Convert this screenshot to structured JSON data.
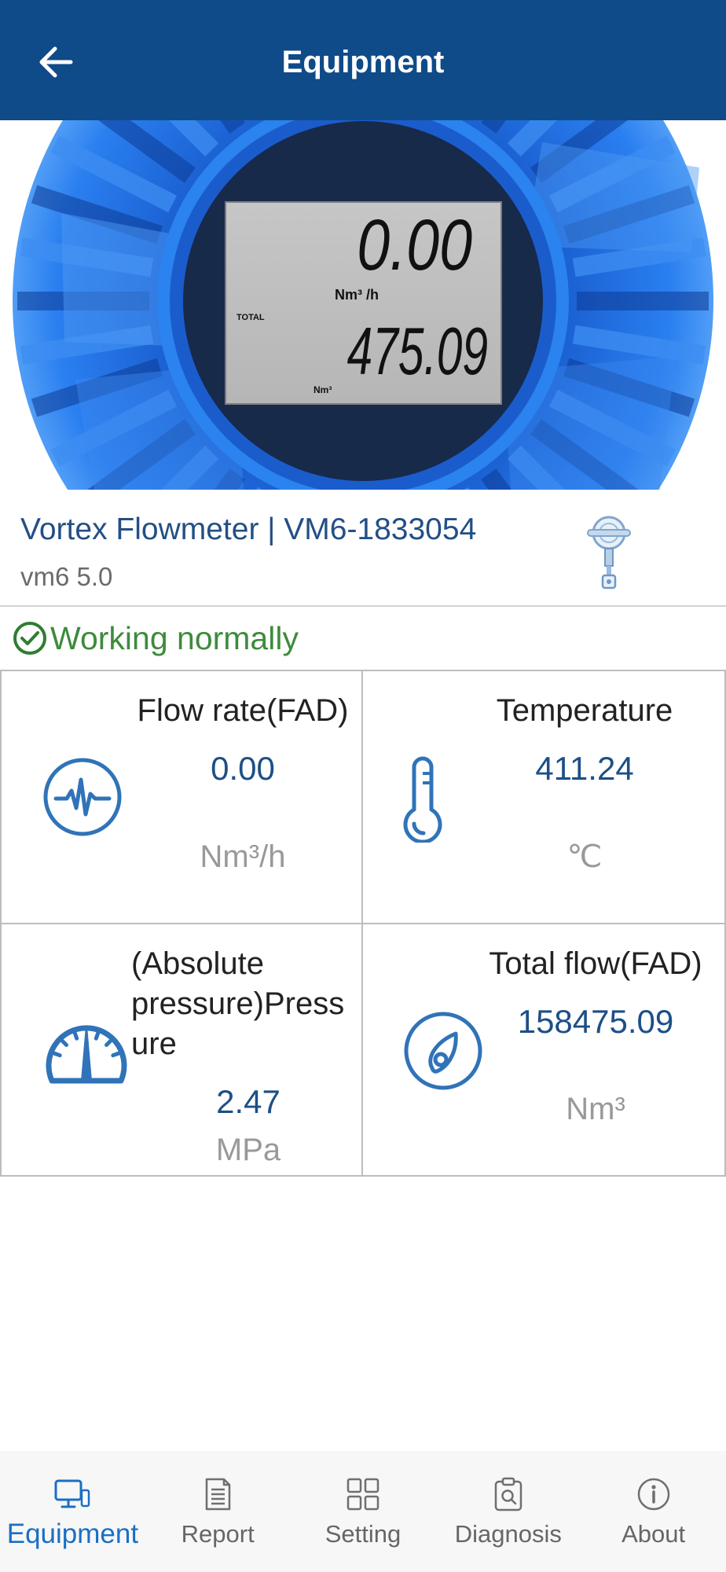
{
  "header": {
    "title": "Equipment",
    "back_icon": "arrow-left-icon"
  },
  "hero": {
    "lcd": {
      "flow_value": "0.00",
      "flow_unit": "Nm³ /h",
      "total_label": "TOTAL",
      "total_value": "475.09",
      "total_unit": "Nm³"
    }
  },
  "device": {
    "name": "Vortex Flowmeter",
    "serial": "| VM6-1833054",
    "version": "vm6 5.0",
    "icon": "flowmeter-device-icon"
  },
  "status": {
    "text": "Working normally",
    "icon": "check-circle-icon"
  },
  "metrics": [
    {
      "label": "Flow rate(FAD)",
      "value": "0.00",
      "unit": "Nm³/h",
      "icon": "pulse-icon"
    },
    {
      "label": "Temperature",
      "value": "411.24",
      "unit": "℃",
      "icon": "thermometer-icon"
    },
    {
      "label": "(Absolute pressure)Pressure",
      "value": "2.47",
      "unit": "MPa",
      "icon": "gauge-icon"
    },
    {
      "label": "Total flow(FAD)",
      "value": "158475.09",
      "unit": "Nm³",
      "icon": "flow-meter-icon"
    }
  ],
  "nav": {
    "active_index": 0,
    "items": [
      {
        "label": "Equipment",
        "icon": "monitor-phone-icon"
      },
      {
        "label": "Report",
        "icon": "document-icon"
      },
      {
        "label": "Setting",
        "icon": "grid-icon"
      },
      {
        "label": "Diagnosis",
        "icon": "clipboard-search-icon"
      },
      {
        "label": "About",
        "icon": "info-icon"
      }
    ]
  },
  "colors": {
    "header_bg": "#0f4a89",
    "accent": "#1a6fc4",
    "value_text": "#1d4f86",
    "status_ok": "#3d8b3d",
    "icon": "#3073b8",
    "unit_text": "#999999"
  }
}
